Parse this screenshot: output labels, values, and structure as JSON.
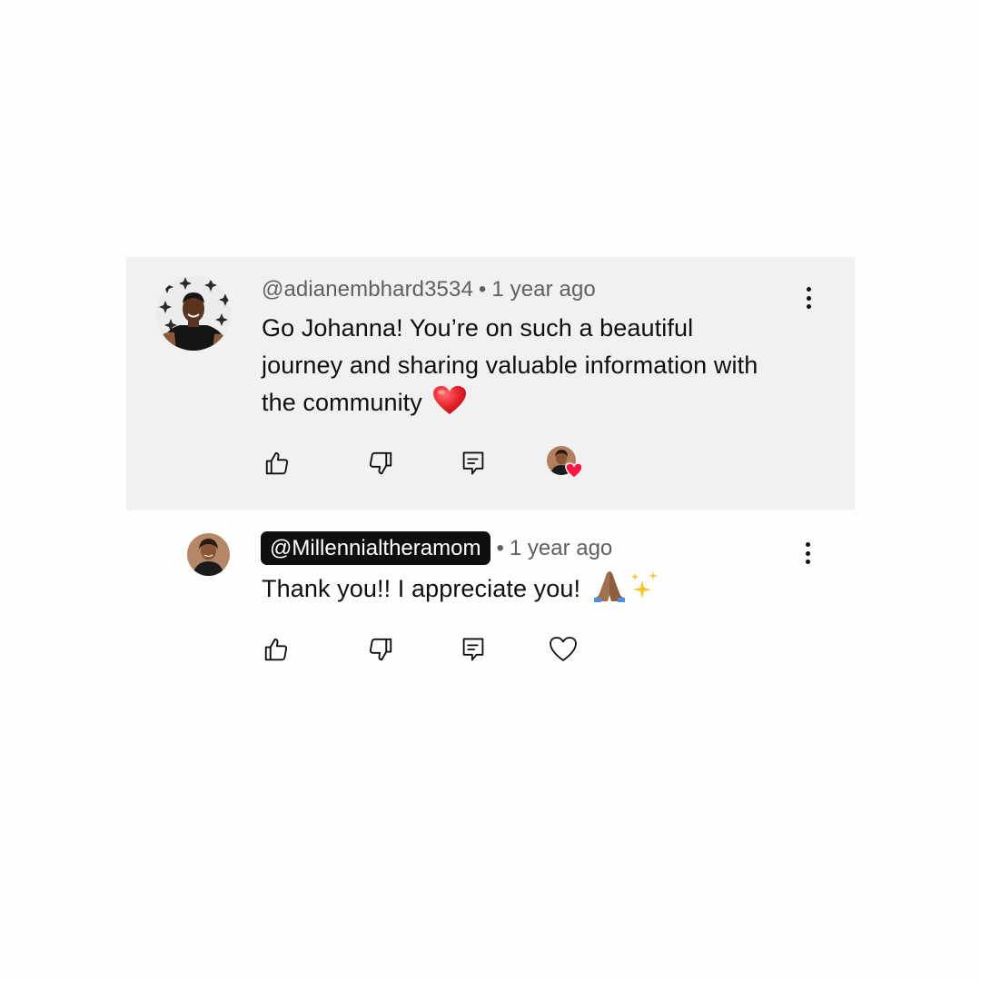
{
  "comment": {
    "author": "@adianembhard3534",
    "separator": "•",
    "time": "1 year ago",
    "text": "Go Johanna! You’re on such a beautiful journey and sharing valuable information with the community",
    "emoji": "❤️",
    "icons": {
      "like": "thumbs-up-icon",
      "dislike": "thumbs-down-icon",
      "reply": "reply-icon",
      "more": "more-vertical-icon",
      "hearted": "creator-heart-icon"
    }
  },
  "reply": {
    "author": "@Millennialtheramom",
    "separator": "•",
    "time": "1 year ago",
    "text": "Thank you!! I appreciate you!",
    "emoji": "🙏🏽✨",
    "icons": {
      "like": "thumbs-up-icon",
      "dislike": "thumbs-down-icon",
      "reply": "reply-icon",
      "heart": "heart-outline-icon",
      "more": "more-vertical-icon"
    }
  },
  "colors": {
    "highlight_background": "#f1f1f1",
    "text_primary": "#0f0f0f",
    "text_secondary": "#606060",
    "author_chip": "#0f0f0f",
    "heart_red": "#ff1744"
  }
}
